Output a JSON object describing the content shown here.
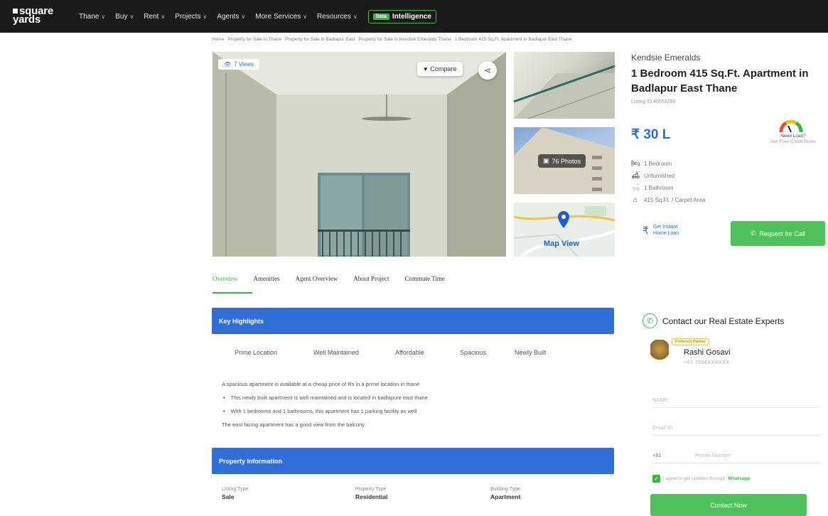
{
  "brand": {
    "line1": "square",
    "line2": "yards"
  },
  "nav": {
    "items": [
      {
        "label": "Thane",
        "chevron": true
      },
      {
        "label": "Buy",
        "chevron": true
      },
      {
        "label": "Rent",
        "chevron": true
      },
      {
        "label": "Projects",
        "chevron": true
      },
      {
        "label": "Agents",
        "chevron": true
      },
      {
        "label": "More Services",
        "chevron": true
      },
      {
        "label": "Resources",
        "chevron": true
      }
    ],
    "intelligence_badge": "Data",
    "intelligence_label": "Intelligence",
    "chevron_glyph": "∨"
  },
  "breadcrumb": [
    "Home",
    "Property for Sale in Thane",
    "Property for Sale in Badlapur East",
    "Property for Sale in Kendsie Emeralds Thane",
    "1 Bedroom 415 Sq.Ft. Apartment in Badlapur East Thane"
  ],
  "gallery": {
    "views_label": "7 Views",
    "compare_label": "Compare",
    "photos_label": "76 Photos",
    "map_label": "Map View"
  },
  "property": {
    "project_name": "Kendsie Emeralds",
    "title": "1 Bedroom 415 Sq.Ft. Apartment in Badlapur East Thane",
    "listing_id": "Listing ID 40053298",
    "price": "₹ 30 L",
    "loan_title": "Need Loan?",
    "loan_sub": "Get Free Credit Score",
    "features": [
      {
        "icon": "bed-icon",
        "glyph": "🛏",
        "label": "1 Bedroom"
      },
      {
        "icon": "sofa-icon",
        "glyph": "🛋",
        "label": "Unfurnished"
      },
      {
        "icon": "bathtub-icon",
        "glyph": "🛁",
        "label": "1 Bathroom"
      },
      {
        "icon": "home-icon",
        "glyph": "⌂",
        "label": "415 Sq.Ft. / Carpet Area"
      }
    ],
    "instant_loan": "Get Instant Home Loan",
    "request_call": "Request for Call"
  },
  "tabs": [
    {
      "label": "Overview",
      "active": true
    },
    {
      "label": "Amenities",
      "active": false
    },
    {
      "label": "Agent Overview",
      "active": false
    },
    {
      "label": "About Project",
      "active": false
    },
    {
      "label": "Commute Time",
      "active": false
    }
  ],
  "key_highlights": {
    "title": "Key Highlights",
    "items": [
      "Prime Location",
      "Well Maintained",
      "Affordable",
      "Spacious",
      "Newly Built"
    ],
    "intro": "A spacious apartment is available at a cheap price of Rs in a prime location in thane",
    "bullets": [
      "This newly built apartment is well maintained and is located in badlapure east thane",
      "With 1 bedrooms and 1 bathrooms, this apartment has 1 parking facility as well"
    ],
    "outro": "The east facing apartment has a good view from the balcony"
  },
  "property_information": {
    "title": "Property Information",
    "fields": [
      {
        "label": "Listing Type",
        "value": "Sale"
      },
      {
        "label": "Property Type",
        "value": "Residential"
      },
      {
        "label": "Building Type",
        "value": "Apartment"
      }
    ]
  },
  "contact": {
    "title": "Contact our Real Estate Experts",
    "badge": "Preferred Partner",
    "agent_name": "Rashi Gosavi",
    "agent_phone": "+91 7506XXXXXX",
    "name_placeholder": "NAME",
    "email_placeholder": "Email ID",
    "country_code": "+91",
    "phone_placeholder": "Phone Number",
    "consent_text": "I agree to get updates through",
    "consent_channel": "Whatsapp",
    "button": "Contact Now"
  },
  "colors": {
    "accent_green": "#3bb54a",
    "accent_blue": "#2f6fd7",
    "nav_bg": "#1a1a1a"
  }
}
